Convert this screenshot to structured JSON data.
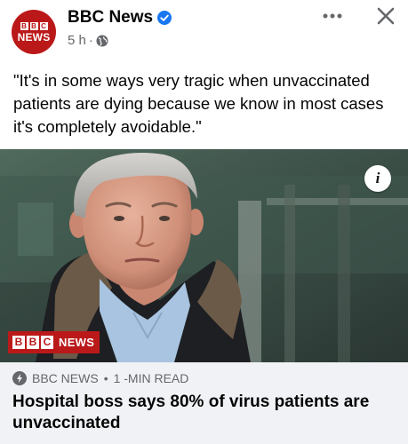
{
  "post": {
    "page_name": "BBC News",
    "avatar_blocks": [
      "B",
      "B",
      "C"
    ],
    "avatar_word": "NEWS",
    "time": "5 h",
    "separator": "·",
    "text": "\"It's in some ways very tragic when unvaccinated patients are dying because we know in most cases it's completely avoidable.\""
  },
  "image": {
    "logo_blocks": [
      "B",
      "B",
      "C"
    ],
    "logo_word": "NEWS",
    "info_label": "i"
  },
  "link": {
    "source": "BBC NEWS",
    "separator": "•",
    "read_time": "1 -MIN READ",
    "headline": "Hospital boss says 80% of virus patients are unvaccinated"
  },
  "colors": {
    "bbc_red": "#bb1919",
    "verified_blue": "#1877f2",
    "muted_text": "#65676b",
    "card_bg": "#f0f2f5"
  },
  "icons": [
    "verified-badge-icon",
    "globe-icon",
    "more-options-icon",
    "close-icon",
    "info-icon",
    "amp-lightning-icon"
  ]
}
